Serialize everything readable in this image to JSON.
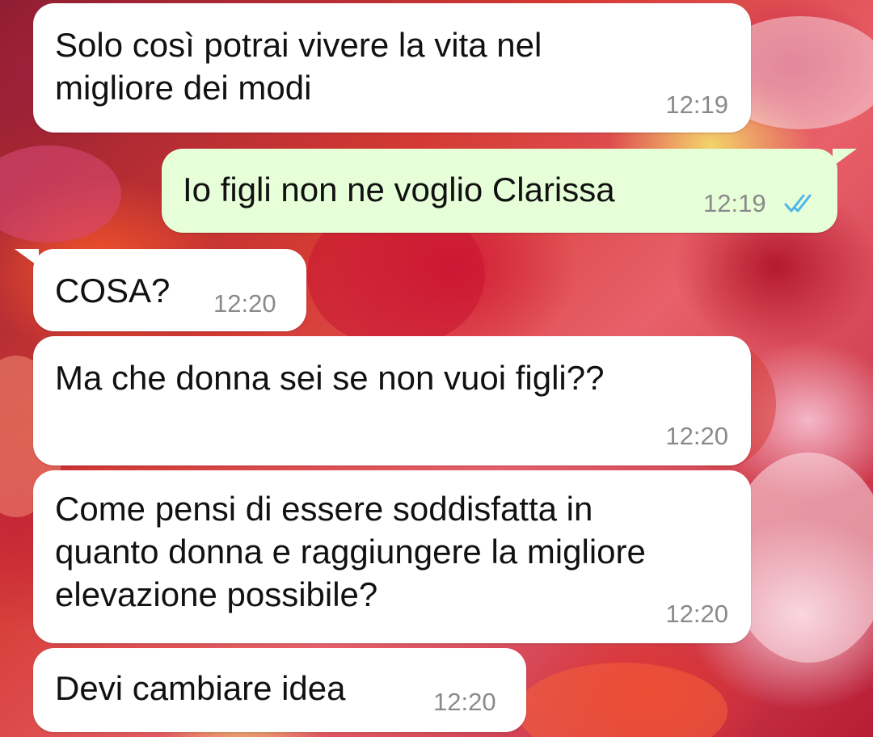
{
  "messages": [
    {
      "direction": "incoming",
      "text": "Solo così potrai vivere la vita nel\nmigliore dei modi",
      "time": "12:19"
    },
    {
      "direction": "outgoing",
      "text": "Io figli non ne voglio Clarissa",
      "time": "12:19",
      "status": "read",
      "status_icon": "double-check-icon"
    },
    {
      "direction": "incoming",
      "text": "COSA?",
      "time": "12:20"
    },
    {
      "direction": "incoming",
      "text": "Ma che donna sei se non vuoi figli??",
      "time": "12:20"
    },
    {
      "direction": "incoming",
      "text": "Come pensi di essere soddisfatta in\nquanto donna e raggiungere la migliore\nelevazione possibile?",
      "time": "12:20"
    },
    {
      "direction": "incoming",
      "text": "Devi cambiare idea",
      "time": "12:20"
    }
  ],
  "colors": {
    "incoming_bubble": "#ffffff",
    "outgoing_bubble": "#e6ffd8",
    "timestamp": "#8a8a8a",
    "read_ticks": "#4fb6ec",
    "text": "#111111"
  },
  "wallpaper": "flower-bouquet-image"
}
